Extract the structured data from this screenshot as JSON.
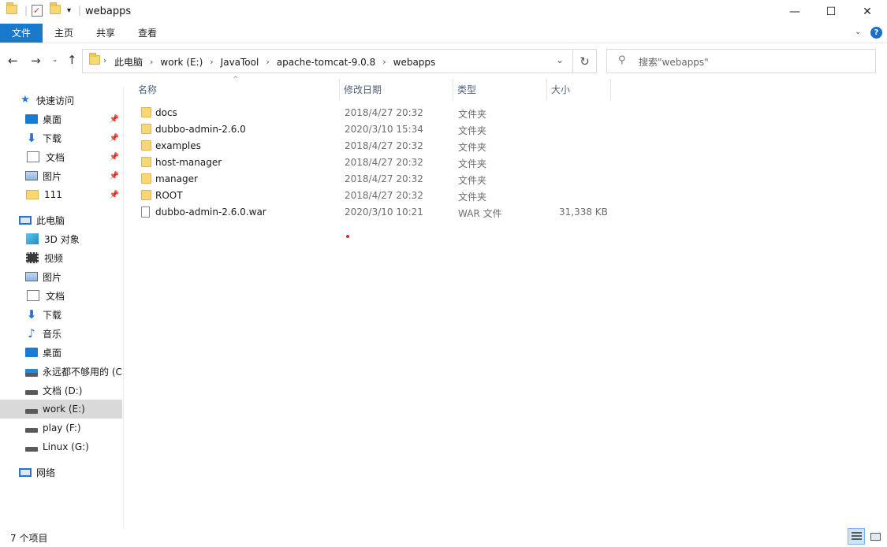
{
  "window": {
    "title": "webapps",
    "controls": {
      "minimize": "—",
      "maximize": "☐",
      "close": "✕"
    }
  },
  "ribbon": {
    "tabs": [
      "文件",
      "主页",
      "共享",
      "查看"
    ]
  },
  "address": {
    "crumbs": [
      "此电脑",
      "work (E:)",
      "JavaTool",
      "apache-tomcat-9.0.8",
      "webapps"
    ]
  },
  "search": {
    "placeholder": "搜索\"webapps\""
  },
  "sidebar": {
    "quick_access_label": "快速访问",
    "quick_access": [
      {
        "label": "桌面",
        "icon": "desktop-icon"
      },
      {
        "label": "下载",
        "icon": "download-icon"
      },
      {
        "label": "文档",
        "icon": "document-icon"
      },
      {
        "label": "图片",
        "icon": "pictures-icon"
      },
      {
        "label": "111",
        "icon": "folder-icon"
      }
    ],
    "this_pc_label": "此电脑",
    "this_pc": [
      {
        "label": "3D 对象",
        "icon": "3d-objects-icon"
      },
      {
        "label": "视频",
        "icon": "videos-icon"
      },
      {
        "label": "图片",
        "icon": "pictures-icon"
      },
      {
        "label": "文档",
        "icon": "document-icon"
      },
      {
        "label": "下载",
        "icon": "download-icon"
      },
      {
        "label": "音乐",
        "icon": "music-icon"
      },
      {
        "label": "桌面",
        "icon": "desktop-icon"
      },
      {
        "label": "永远都不够用的 (C:",
        "icon": "system-drive-icon"
      },
      {
        "label": "文档 (D:)",
        "icon": "drive-icon"
      },
      {
        "label": "work (E:)",
        "icon": "drive-icon",
        "selected": true
      },
      {
        "label": "play (F:)",
        "icon": "drive-icon"
      },
      {
        "label": "Linux (G:)",
        "icon": "drive-icon"
      }
    ],
    "network_label": "网络"
  },
  "columns": {
    "name": "名称",
    "date": "修改日期",
    "type": "类型",
    "size": "大小"
  },
  "files": [
    {
      "name": "docs",
      "date": "2018/4/27 20:32",
      "type": "文件夹",
      "size": "",
      "kind": "folder"
    },
    {
      "name": "dubbo-admin-2.6.0",
      "date": "2020/3/10 15:34",
      "type": "文件夹",
      "size": "",
      "kind": "folder"
    },
    {
      "name": "examples",
      "date": "2018/4/27 20:32",
      "type": "文件夹",
      "size": "",
      "kind": "folder"
    },
    {
      "name": "host-manager",
      "date": "2018/4/27 20:32",
      "type": "文件夹",
      "size": "",
      "kind": "folder"
    },
    {
      "name": "manager",
      "date": "2018/4/27 20:32",
      "type": "文件夹",
      "size": "",
      "kind": "folder"
    },
    {
      "name": "ROOT",
      "date": "2018/4/27 20:32",
      "type": "文件夹",
      "size": "",
      "kind": "folder"
    },
    {
      "name": "dubbo-admin-2.6.0.war",
      "date": "2020/3/10 10:21",
      "type": "WAR 文件",
      "size": "31,338 KB",
      "kind": "file"
    }
  ],
  "status": {
    "item_count": "7 个项目"
  }
}
